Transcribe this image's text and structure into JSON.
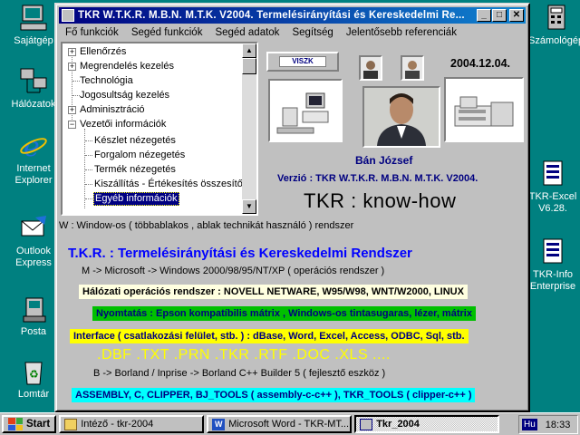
{
  "desktop": {
    "left_icons": [
      {
        "name": "my-computer-icon",
        "label": "Sajátgép"
      },
      {
        "name": "network-icon",
        "label": "Hálózatok"
      },
      {
        "name": "internet-explorer-icon",
        "label": "Internet Explorer"
      },
      {
        "name": "outlook-express-icon",
        "label": "Outlook Express"
      },
      {
        "name": "post-icon",
        "label": "Posta"
      },
      {
        "name": "recycle-bin-icon",
        "label": "Lomtár"
      }
    ],
    "right_icons": [
      {
        "name": "calculator-icon",
        "label": "Számológép"
      },
      {
        "name": "tkr-excel-icon",
        "label": "TKR-Excel V6.28."
      },
      {
        "name": "tkr-info-icon",
        "label": "TKR-Info Enterprise"
      }
    ]
  },
  "window": {
    "title": "TKR W.T.K.R. M.B.N. M.T.K. V2004. Termelésirányítási és Kereskedelmi Re...",
    "buttons": {
      "minimize": "_",
      "maximize": "□",
      "close": "✕"
    },
    "menu": [
      "Fő funkciók",
      "Segéd funkciók",
      "Segéd adatok",
      "Segítség",
      "Jelentősebb referenciák"
    ]
  },
  "tree": {
    "items": [
      {
        "label": "Ellenőrzés",
        "expander": "+"
      },
      {
        "label": "Megrendelés kezelés",
        "expander": "+"
      },
      {
        "label": "Technológia",
        "expander": ""
      },
      {
        "label": "Jogosultság kezelés",
        "expander": ""
      },
      {
        "label": "Adminisztráció",
        "expander": "+"
      },
      {
        "label": "Vezetői információk",
        "expander": "−"
      }
    ],
    "children": [
      {
        "label": "Készlet nézegetés"
      },
      {
        "label": "Forgalom nézegetés"
      },
      {
        "label": "Termék nézegetés"
      },
      {
        "label": "Kiszállítás - Értékesítés összesítő"
      },
      {
        "label": "Egyéb információk",
        "selected": true
      }
    ]
  },
  "header": {
    "logo_text": "VISZK",
    "date": "2004.12.04.",
    "person_name": "Bán József",
    "version": "Verzió : TKR W.T.K.R. M.B.N. M.T.K. V2004.",
    "slogan": "TKR :  know-how"
  },
  "info": {
    "w_line": "W : Window-os ( többablakos , ablak technikát használó ) rendszer",
    "big_title": "T.K.R. : Termelésirányítási és Kereskedelmi Rendszer",
    "m_line": "M -> Microsoft -> Windows 2000/98/95/NT/XP       ( operációs rendszer )",
    "network": "Hálózati operációs rendszer : NOVELL NETWARE, W95/W98, WNT/W2000, LINUX",
    "printing": "Nyomtatás : Epson kompatíbilis mátrix ,  Windows-os tintasugaras, lézer, mátrix",
    "interface": "Interface ( csatlakozási felület, stb. )  : dBase, Word, Excel, Access, ODBC, Sql, stb.",
    "extensions": ".DBF   .TXT   .PRN   .TKR   .RTF   .DOC   .XLS   ....",
    "b_line": "B -> Borland / Inprise -> Borland C++ Builder 5     ( fejlesztő eszköz )",
    "tools": "ASSEMBLY, C, CLIPPER, BJ_TOOLS ( assembly-c-c++ ), TKR_TOOLS ( clipper-c++ )"
  },
  "colors": {
    "network_bg": "#ffffe0",
    "printing_bg": "#00c000",
    "printing_fg": "#000080",
    "interface_bg": "#ffff00",
    "tools_bg": "#00ffff",
    "extensions_fg": "#ffff00",
    "accent_blue": "#0000ff"
  },
  "taskbar": {
    "start": "Start",
    "tasks": [
      {
        "label": "Intéző - tkr-2004",
        "active": false
      },
      {
        "label": "Microsoft Word - TKR-MT...",
        "active": false
      },
      {
        "label": "Tkr_2004",
        "active": true
      }
    ],
    "lang": "Hu",
    "clock": "18:33"
  }
}
